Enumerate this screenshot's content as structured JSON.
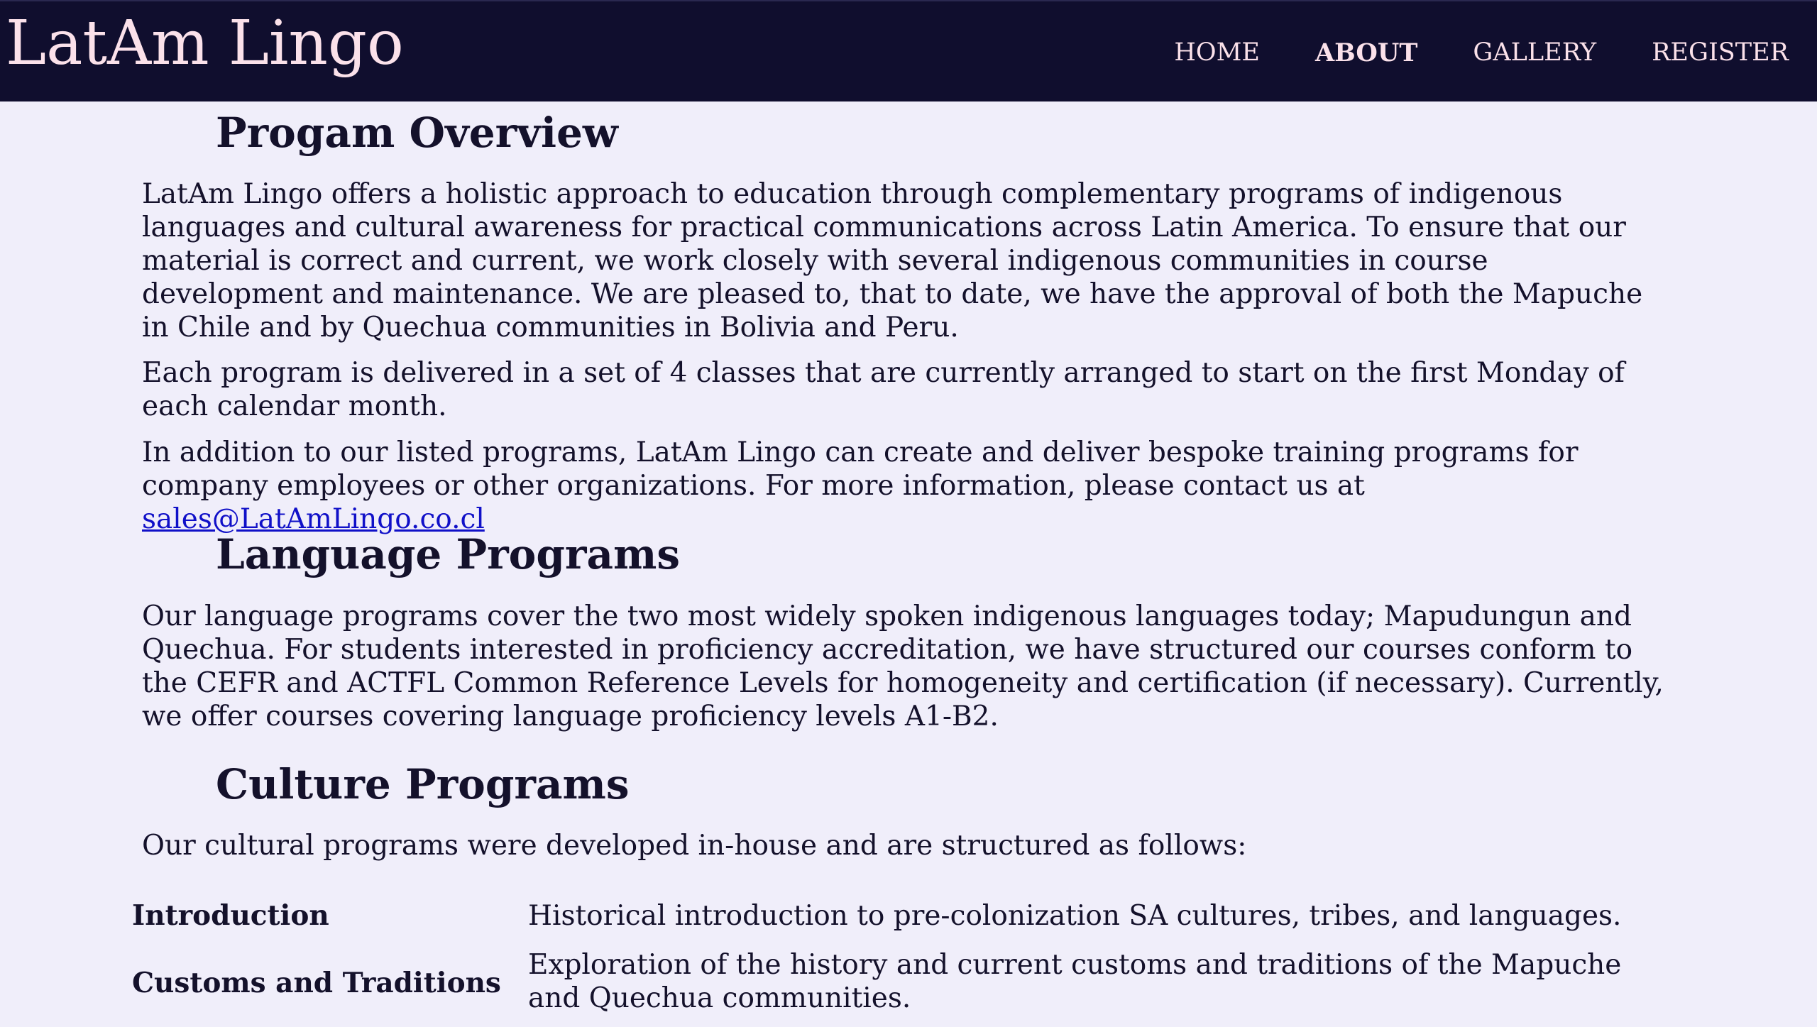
{
  "header": {
    "brand": "LatAm Lingo",
    "nav": [
      {
        "label": "HOME",
        "active": false
      },
      {
        "label": "ABOUT",
        "active": true
      },
      {
        "label": "GALLERY",
        "active": false
      },
      {
        "label": "REGISTER",
        "active": false
      }
    ]
  },
  "overview": {
    "title": "Progam Overview",
    "para1": "LatAm Lingo offers a holistic approach to education through complementary programs of indigenous languages and cultural awareness for practical communications across Latin America. To ensure that our material is correct and current, we work closely with several indigenous communities in course development and maintenance. We are pleased to, that to date, we have the approval of both the Mapuche in Chile and by Quechua communities in Bolivia and Peru.",
    "para2": "Each program is delivered in a set of 4 classes that are currently arranged to start on the first Monday of each calendar month.",
    "para3_prefix": "In addition to our listed programs, LatAm Lingo can create and deliver bespoke training programs for company employees or other organizations. For more information, please contact us at ",
    "email": "sales@LatAmLingo.co.cl"
  },
  "language": {
    "title": "Language Programs",
    "para": "Our language programs cover the two most widely spoken indigenous languages today; Mapudungun and Quechua. For students interested in proficiency accreditation, we have structured our courses conform to the CEFR and ACTFL Common Reference Levels for homogeneity and certification (if necessary). Currently, we offer courses covering language proficiency levels A1-B2."
  },
  "culture": {
    "title": "Culture Programs",
    "intro": "Our cultural programs were developed in-house and are structured as follows:",
    "programs": [
      {
        "name": "Introduction",
        "desc": "Historical introduction to pre-colonization SA cultures, tribes, and languages."
      },
      {
        "name": "Customs and Traditions",
        "desc": "Exploration of the history and current customs and traditions of the Mapuche and Quechua communities."
      }
    ]
  },
  "colors": {
    "header_bg": "#100e2e",
    "header_text": "#fbe1ea",
    "page_bg": "#f0eefa",
    "body_text": "#14112b",
    "link": "#1010c8"
  }
}
